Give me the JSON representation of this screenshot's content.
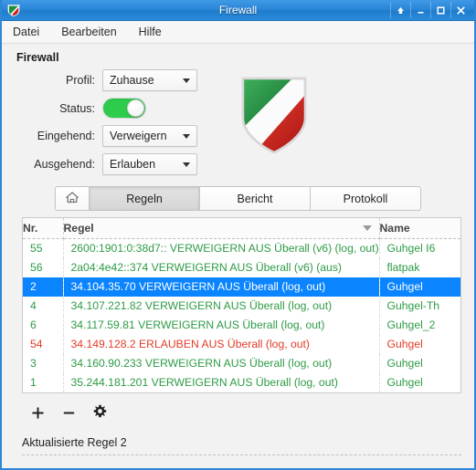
{
  "window": {
    "title": "Firewall",
    "icon": "shield-icon",
    "buttons": [
      {
        "name": "shade-button",
        "glyph": "↑"
      },
      {
        "name": "minimize-button",
        "glyph": "–"
      },
      {
        "name": "maximize-button",
        "glyph": "□"
      },
      {
        "name": "close-button",
        "glyph": "✕"
      }
    ]
  },
  "menubar": {
    "items": [
      {
        "label": "Datei"
      },
      {
        "label": "Bearbeiten"
      },
      {
        "label": "Hilfe"
      }
    ]
  },
  "section": {
    "title": "Firewall"
  },
  "settings": {
    "profile": {
      "label": "Profil:",
      "value": "Zuhause"
    },
    "status": {
      "label": "Status:",
      "value": "on"
    },
    "incoming": {
      "label": "Eingehend:",
      "value": "Verweigern"
    },
    "outgoing": {
      "label": "Ausgehend:",
      "value": "Erlauben"
    }
  },
  "tabs": {
    "home_icon": "home-icon",
    "items": [
      {
        "label": "Regeln",
        "active": true
      },
      {
        "label": "Bericht",
        "active": false
      },
      {
        "label": "Protokoll",
        "active": false
      }
    ]
  },
  "table": {
    "columns": [
      "Nr.",
      "Regel",
      "Name"
    ],
    "sort_indicator": "chevron-down-icon",
    "rows": [
      {
        "nr": "55",
        "regel": "2600:1901:0:38d7:: VERWEIGERN AUS Überall (v6) (log, out)",
        "name": "Guhgel I6",
        "kind": "deny",
        "selected": false
      },
      {
        "nr": "56",
        "regel": "2a04:4e42::374 VERWEIGERN AUS Überall (v6) (aus)",
        "name": "flatpak",
        "kind": "deny",
        "selected": false
      },
      {
        "nr": "2",
        "regel": "34.104.35.70 VERWEIGERN AUS Überall (log, out)",
        "name": "Guhgel",
        "kind": "deny",
        "selected": true
      },
      {
        "nr": "4",
        "regel": "34.107.221.82 VERWEIGERN AUS Überall (log, out)",
        "name": "Guhgel-Th",
        "kind": "deny",
        "selected": false
      },
      {
        "nr": "6",
        "regel": "34.117.59.81 VERWEIGERN AUS Überall (log, out)",
        "name": "Guhgel_2",
        "kind": "deny",
        "selected": false
      },
      {
        "nr": "54",
        "regel": "34.149.128.2 ERLAUBEN AUS Überall (log, out)",
        "name": "Guhgel",
        "kind": "allow",
        "selected": false
      },
      {
        "nr": "3",
        "regel": "34.160.90.233 VERWEIGERN AUS Überall (log, out)",
        "name": "Guhgel",
        "kind": "deny",
        "selected": false
      },
      {
        "nr": "1",
        "regel": "35.244.181.201 VERWEIGERN AUS Überall (log, out)",
        "name": "Guhgel",
        "kind": "deny",
        "selected": false
      }
    ]
  },
  "actions": [
    {
      "name": "add-rule-button",
      "glyph": "+"
    },
    {
      "name": "remove-rule-button",
      "glyph": "−"
    },
    {
      "name": "rule-settings-button",
      "glyph": "gear-icon"
    }
  ],
  "statusbar": {
    "text": "Aktualisierte Regel 2"
  },
  "colors": {
    "titlebar": "#2a86d8",
    "window_border": "#2f86d6",
    "selection": "#0a84ff",
    "deny_rule": "#2e9b46",
    "allow_rule": "#e23c28",
    "toggle_on": "#2ecc4c",
    "shield_green": "#1f8f3c",
    "shield_red": "#cf2020"
  }
}
